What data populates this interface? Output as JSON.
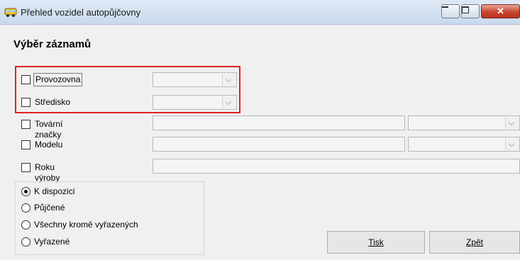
{
  "window": {
    "title": "Přehled vozidel autopůjčovny",
    "close_symbol": "✕"
  },
  "section_title": "Výběr záznamů",
  "filters": [
    {
      "label": "Provozovna",
      "checked": false
    },
    {
      "label": "Středisko",
      "checked": false
    },
    {
      "label": "Tovární značky",
      "checked": false
    },
    {
      "label": "Modelu",
      "checked": false
    },
    {
      "label": "Roku výroby",
      "checked": false
    }
  ],
  "status_options": [
    {
      "label": "K dispozici",
      "selected": true
    },
    {
      "label": "Půjčené",
      "selected": false
    },
    {
      "label": "Všechny kromě vyřazených",
      "selected": false
    },
    {
      "label": "Vyřazené",
      "selected": false
    }
  ],
  "buttons": {
    "print_label": "Tisk",
    "back_label": "Zpět"
  },
  "colors": {
    "highlight": "#e0211f",
    "background": "#f0f0f0"
  },
  "icons": {
    "app": "car-icon",
    "minimize": "minimize-icon",
    "maximize": "maximize-icon",
    "close": "close-icon"
  }
}
